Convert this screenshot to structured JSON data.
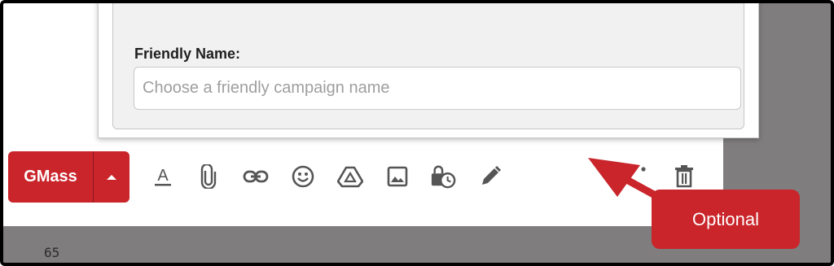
{
  "dialog": {
    "field_label": "Friendly Name:",
    "field_placeholder": "Choose a friendly campaign name",
    "field_value": ""
  },
  "compose_toolbar": {
    "send_label": "GMass",
    "icons": [
      "format-text-icon",
      "attach-icon",
      "link-icon",
      "emoji-icon",
      "drive-icon",
      "photo-icon",
      "confidential-mode-icon",
      "signature-icon",
      "more-options-icon",
      "trash-icon"
    ]
  },
  "callout": {
    "text": "Optional",
    "color": "#c9252b"
  },
  "page_number": "65"
}
